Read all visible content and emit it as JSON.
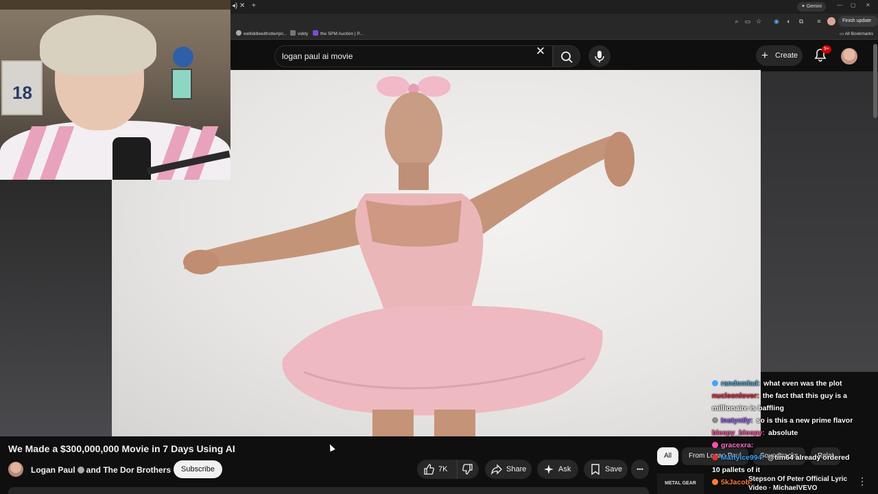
{
  "browser": {
    "gemini_label": "Gemini",
    "finish_update": "Finish update",
    "bookmarks": [
      "welliddlewithstte#pri...",
      "viddy",
      "the SPM Auction | P..."
    ],
    "all_bookmarks": "All Bookmarks"
  },
  "webcam": {
    "poster_number": "18"
  },
  "youtube": {
    "search_value": "logan paul ai movie",
    "create_label": "Create",
    "notification_count": "9+",
    "video_title": "We Made a $300,000,000 Movie in 7 Days Using AI",
    "channel": "Logan Paul",
    "channel_and": "and The Dor Brothers",
    "subscribe_label": "Subscribe",
    "like_count": "7K",
    "share_label": "Share",
    "ask_label": "Ask",
    "save_label": "Save",
    "more_label": "•••",
    "filters": [
      "All",
      "From Logan Paul",
      "Soundtracks",
      "Relat"
    ],
    "rec_thumb_text": "METAL GEAR SOLID",
    "rec_title_line1": "Stepson Of Peter Official Lyric",
    "rec_title_line2": "Video · MichaelVEVO"
  },
  "chat": [
    {
      "user": "randomlad:",
      "msg": "what even was the plot",
      "color": "#4fa8d8",
      "badge": "#3ea6ff"
    },
    {
      "user": "nucleonlover:",
      "msg": "the fact that this guy is a",
      "color": "#e0243a",
      "badge": ""
    },
    {
      "user": "",
      "msg": "millionaire is baffling",
      "color": "#ffffff",
      "badge": ""
    },
    {
      "user": "Instyntly:",
      "msg": "so is this a new prime flavor",
      "color": "#9b5cff",
      "badge": "#8a8a8a"
    },
    {
      "user": "bleepy_bloopy:",
      "msg": "absolute",
      "color": "#ff4fa0",
      "badge": ""
    },
    {
      "user": "gracexra:",
      "msg": "",
      "color": "#ff6fd0",
      "badge": "#ff4fb0"
    },
    {
      "user": "Mattylce994:",
      "msg": "@tim64 already ordered",
      "color": "#3ea6ff",
      "badge": "#d33"
    },
    {
      "user": "",
      "msg": "10 pallets of it",
      "color": "#ffffff",
      "badge": ""
    },
    {
      "user": "5kJacob:",
      "msg": "",
      "color": "#ff7a3a",
      "badge": "#ff7a3a"
    }
  ],
  "icons": [
    "search-icon",
    "mic-icon",
    "bell-icon",
    "like-icon",
    "dislike-icon",
    "share-icon",
    "ask-icon",
    "save-icon",
    "close-icon"
  ]
}
